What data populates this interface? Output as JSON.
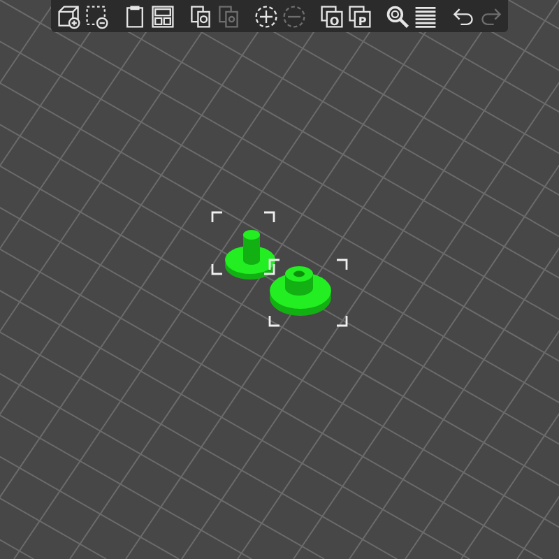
{
  "toolbar": [
    {
      "kind": "add",
      "disabled": false
    },
    {
      "kind": "delete",
      "disabled": false
    },
    {
      "kind": "delete_all",
      "disabled": false
    },
    {
      "kind": "arrange",
      "disabled": false
    },
    {
      "kind": "copy",
      "disabled": false
    },
    {
      "kind": "paste",
      "disabled": true
    },
    {
      "kind": "add_instance",
      "disabled": false
    },
    {
      "kind": "remove_instance",
      "disabled": true
    },
    {
      "kind": "split_objects",
      "label": "O",
      "disabled": false
    },
    {
      "kind": "split_parts",
      "label": "P",
      "disabled": false
    },
    {
      "kind": "search",
      "disabled": false
    },
    {
      "kind": "layers",
      "disabled": false
    },
    {
      "kind": "undo",
      "disabled": false
    },
    {
      "kind": "redo",
      "disabled": true
    }
  ],
  "scene": {
    "objects": [
      {
        "kind": "small_peg",
        "selected": true
      },
      {
        "kind": "large_peg",
        "selected": true
      }
    ]
  }
}
